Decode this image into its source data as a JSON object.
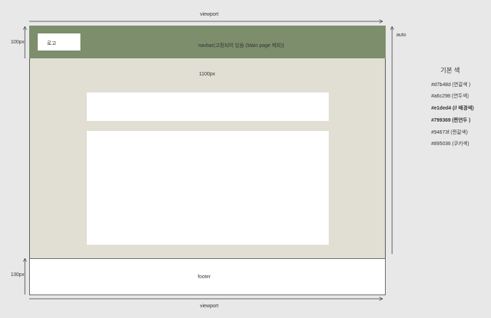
{
  "diagram": {
    "labels": {
      "viewport_top": "viewport",
      "viewport_bottom": "viewport",
      "logo": "로고",
      "navbar": "navbar(고정되어 있음 (Main page 제외))",
      "height_navbar": "100px",
      "width_content": "1100px",
      "height_auto": "auto",
      "footer": "footer",
      "height_footer": "130px"
    }
  },
  "legend": {
    "title": "기본 색",
    "items": [
      {
        "text": "#d7b48d (연갈색 )",
        "bold": false
      },
      {
        "text": "#a6c298 (연두색)",
        "bold": false
      },
      {
        "text": "#e1ded4 (// 배경색)",
        "bold": true
      },
      {
        "text": "#799369 (찐연두 )",
        "bold": true
      },
      {
        "text": "#94673f (찐갈색)",
        "bold": false
      },
      {
        "text": "#895036 (쿠키색)",
        "bold": false
      }
    ]
  },
  "colors": {
    "navbar": "#7c8e6b",
    "main_background": "#e1ded4",
    "page_background": "#e8e8e8",
    "content": "#ffffff"
  }
}
